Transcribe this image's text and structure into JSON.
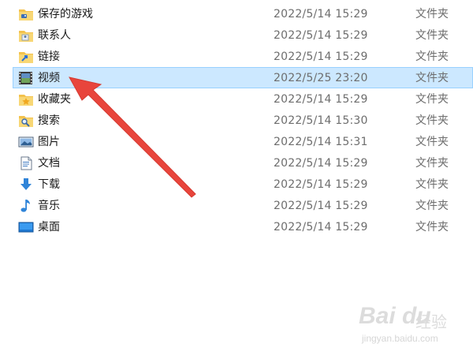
{
  "files": [
    {
      "name": "保存的游戏",
      "date": "2022/5/14 15:29",
      "type": "文件夹",
      "icon": "saved-games-icon",
      "selected": false
    },
    {
      "name": "联系人",
      "date": "2022/5/14 15:29",
      "type": "文件夹",
      "icon": "contacts-icon",
      "selected": false
    },
    {
      "name": "链接",
      "date": "2022/5/14 15:29",
      "type": "文件夹",
      "icon": "links-icon",
      "selected": false
    },
    {
      "name": "视频",
      "date": "2022/5/25 23:20",
      "type": "文件夹",
      "icon": "videos-icon",
      "selected": true
    },
    {
      "name": "收藏夹",
      "date": "2022/5/14 15:29",
      "type": "文件夹",
      "icon": "favorites-icon",
      "selected": false
    },
    {
      "name": "搜索",
      "date": "2022/5/14 15:30",
      "type": "文件夹",
      "icon": "searches-icon",
      "selected": false
    },
    {
      "name": "图片",
      "date": "2022/5/14 15:31",
      "type": "文件夹",
      "icon": "pictures-icon",
      "selected": false
    },
    {
      "name": "文档",
      "date": "2022/5/14 15:29",
      "type": "文件夹",
      "icon": "documents-icon",
      "selected": false
    },
    {
      "name": "下载",
      "date": "2022/5/14 15:29",
      "type": "文件夹",
      "icon": "downloads-icon",
      "selected": false
    },
    {
      "name": "音乐",
      "date": "2022/5/14 15:29",
      "type": "文件夹",
      "icon": "music-icon",
      "selected": false
    },
    {
      "name": "桌面",
      "date": "2022/5/14 15:29",
      "type": "文件夹",
      "icon": "desktop-icon",
      "selected": false
    }
  ],
  "colors": {
    "selection_bg": "#cce8ff",
    "selection_border": "#99d1ff",
    "arrow": "#e8453c",
    "folder": "#f3c24d"
  },
  "watermark": {
    "logo": "Bai du",
    "jingyan": "经验",
    "url": "jingyan.baidu.com"
  }
}
